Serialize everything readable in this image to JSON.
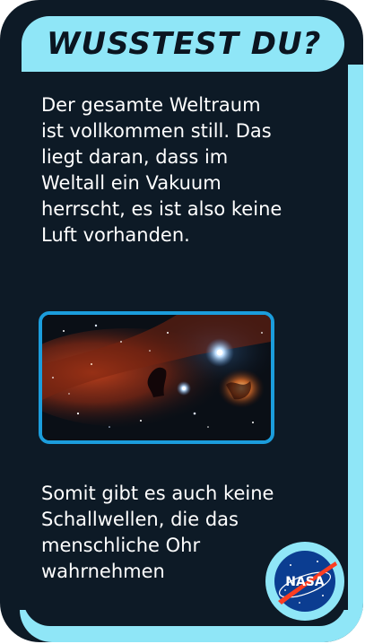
{
  "card": {
    "title": "WUSSTEST DU?",
    "paragraph_1": "Der gesamte Weltraum ist vollkommen still. Das liegt daran, dass im Weltall ein Vakuum herrscht, es ist also keine Luft vorhanden.",
    "paragraph_2": "Somit gibt es auch keine Schallwellen, die das menschliche Ohr wahrnehmen"
  },
  "image": {
    "subject": "nebula-photo"
  },
  "logo": {
    "text": "NASA"
  },
  "colors": {
    "background": "#0d1a26",
    "frame_cyan": "#8fe6f7",
    "photo_border": "#1b9ddc",
    "nasa_blue": "#0b3d91",
    "nasa_red": "#fc3d21"
  }
}
